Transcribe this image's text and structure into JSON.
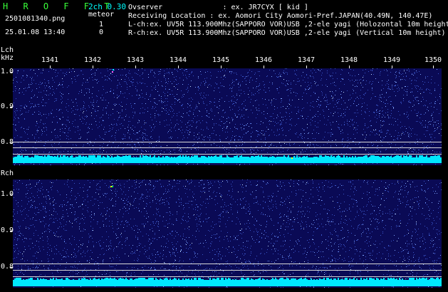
{
  "app": {
    "name": "H R O F F T",
    "version": "2ch 0.30",
    "filename": "2501081340.png",
    "meteor_label": "meteor",
    "datetime": "25.01.08 13:40",
    "lch_count": "1",
    "rch_count": "0"
  },
  "info": {
    "observer": "Ovserver              : ex. JR7CYX [ kid ]",
    "location": "Receiving Location : ex. Aomori City Aomori-Pref.JAPAN(40.49N, 140.47E)",
    "lch": "L-ch:ex. UV5R 113.900Mhz(SAPPORO VOR)USB ,2-ele yagi (Holozontal 10m height)",
    "rch": "R-ch:ex. UV5R 113.900Mhz(SAPPORO VOR)USB ,2-ele yagi (Vertical 10m height)"
  },
  "axes": {
    "lch_label": "Lch",
    "khz_label": "kHz",
    "rch_label": "Rch",
    "y_labels": [
      "1.0",
      "0.9",
      "0.8"
    ],
    "x_labels": [
      "1341",
      "1342",
      "1343",
      "1344",
      "1345",
      "1346",
      "1347",
      "1348",
      "1349",
      "1350"
    ]
  },
  "colors": {
    "background": "#000000",
    "spectrogram": "#0a0a55",
    "noise": "#4a6bd8",
    "baseline": "#00e8ff",
    "meteor": "#ffff00"
  }
}
